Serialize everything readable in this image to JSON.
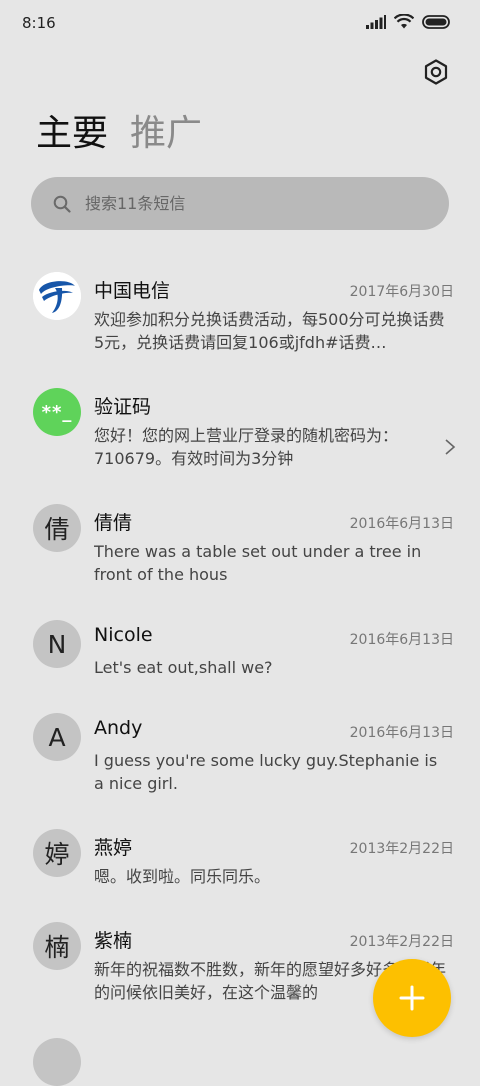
{
  "status": {
    "time": "8:16"
  },
  "tabs": [
    {
      "label": "主要"
    },
    {
      "label": "推广"
    }
  ],
  "search": {
    "placeholder": "搜索11条短信"
  },
  "messages": [
    {
      "sender": "中国电信",
      "date": "2017年6月30日",
      "preview": "欢迎参加积分兑换话费活动，每500分可兑换话费5元，兑换话费请回复106或jfdh#话费…",
      "avatar_type": "logo"
    },
    {
      "sender": "验证码",
      "date": "",
      "preview": "您好！您的网上营业厅登录的随机密码为：710679。有效时间为3分钟",
      "avatar_text": "**_"
    },
    {
      "sender": "倩倩",
      "date": "2016年6月13日",
      "preview": "There was a table set out under a tree in front of the hous",
      "avatar_text": "倩"
    },
    {
      "sender": "Nicole",
      "date": "2016年6月13日",
      "preview": "Let's eat out,shall we?",
      "avatar_text": "N"
    },
    {
      "sender": "Andy",
      "date": "2016年6月13日",
      "preview": "I guess you're some lucky guy.Stephanie is a nice girl.",
      "avatar_text": "A"
    },
    {
      "sender": "燕婷",
      "date": "2013年2月22日",
      "preview": "嗯。收到啦。同乐同乐。",
      "avatar_text": "婷"
    },
    {
      "sender": "紫楠",
      "date": "2013年2月22日",
      "preview": "新年的祝福数不胜数，新年的愿望好多好多，新年的问候依旧美好，在这个温馨的",
      "avatar_text": "楠"
    }
  ],
  "colors": {
    "background": "#e6e6e6",
    "search_bg": "#b9b9b9",
    "fab": "#fdc000",
    "green_avatar": "#5fd35a",
    "telecom_blue": "#1756a9"
  }
}
